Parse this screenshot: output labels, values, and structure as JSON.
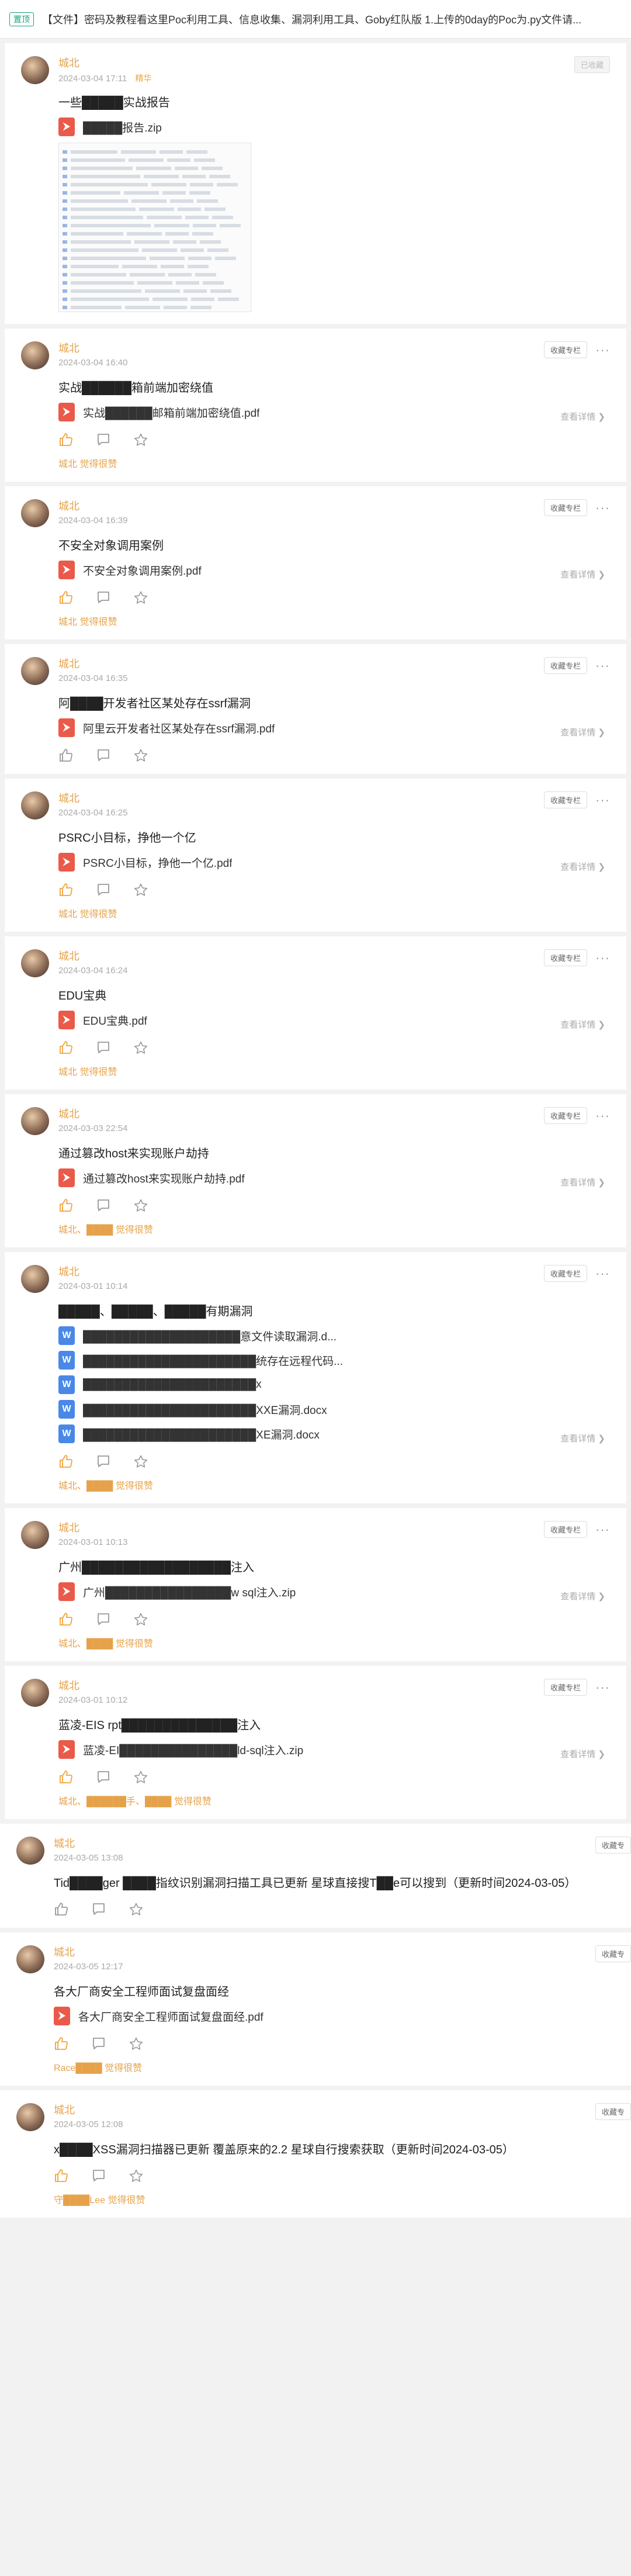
{
  "notice": {
    "tag": "置顶",
    "text": "【文件】密码及教程看这里Poc利用工具、信息收集、漏洞利用工具、Goby红队版 1.上传的0day的Poc为.py文件请..."
  },
  "labels": {
    "collect": "收藏专栏",
    "collected": "已收藏",
    "detail": "查看详情",
    "detail_arrow": "❯",
    "liked_suffix": "觉得很赞",
    "essence": "精华"
  },
  "posts": [
    {
      "author": "城北",
      "time": "2024-03-04 17:11",
      "essence": true,
      "fav": "已收藏",
      "title": "一些█████实战报告",
      "files": [
        {
          "type": "zip",
          "name": "█████报告.zip"
        }
      ],
      "screenshot": true,
      "liked": null
    },
    {
      "author": "城北",
      "time": "2024-03-04 16:40",
      "fav": "收藏专栏",
      "title": "实战██████箱前端加密绕值",
      "files": [
        {
          "type": "pdf",
          "name": "实战██████邮箱前端加密绕值.pdf"
        }
      ],
      "liked": "城北"
    },
    {
      "author": "城北",
      "time": "2024-03-04 16:39",
      "fav": "收藏专栏",
      "title": "不安全对象调用案例",
      "files": [
        {
          "type": "pdf",
          "name": "不安全对象调用案例.pdf"
        }
      ],
      "liked": "城北"
    },
    {
      "author": "城北",
      "time": "2024-03-04 16:35",
      "fav": "收藏专栏",
      "title": "阿████开发者社区某处存在ssrf漏洞",
      "files": [
        {
          "type": "pdf",
          "name": "阿里云开发者社区某处存在ssrf漏洞.pdf"
        }
      ],
      "liked": null
    },
    {
      "author": "城北",
      "time": "2024-03-04 16:25",
      "fav": "收藏专栏",
      "title": "PSRC小目标，挣他一个亿",
      "files": [
        {
          "type": "pdf",
          "name": "PSRC小目标，挣他一个亿.pdf"
        }
      ],
      "liked": "城北"
    },
    {
      "author": "城北",
      "time": "2024-03-04 16:24",
      "fav": "收藏专栏",
      "title": "EDU宝典",
      "files": [
        {
          "type": "pdf",
          "name": "EDU宝典.pdf"
        }
      ],
      "liked": "城北"
    },
    {
      "author": "城北",
      "time": "2024-03-03 22:54",
      "fav": "收藏专栏",
      "title": "通过篡改host来实现账户劫持",
      "files": [
        {
          "type": "pdf",
          "name": "通过篡改host来实现账户劫持.pdf"
        }
      ],
      "liked": "城北、████"
    },
    {
      "author": "城北",
      "time": "2024-03-01 10:14",
      "fav": "收藏专栏",
      "title": "█████、█████、█████有期漏洞",
      "files": [
        {
          "type": "doc",
          "name": "████████████████████意文件读取漏洞.d..."
        },
        {
          "type": "doc",
          "name": "██████████████████████统存在远程代码..."
        },
        {
          "type": "doc",
          "name": "██████████████████████x"
        },
        {
          "type": "doc",
          "name": "██████████████████████XXE漏洞.docx"
        },
        {
          "type": "doc",
          "name": "██████████████████████XE漏洞.docx"
        }
      ],
      "liked": "城北、████"
    },
    {
      "author": "城北",
      "time": "2024-03-01 10:13",
      "fav": "收藏专栏",
      "title": "广州██████████████████注入",
      "files": [
        {
          "type": "zip",
          "name": "广州████████████████w sql注入.zip"
        }
      ],
      "liked": "城北、████"
    },
    {
      "author": "城北",
      "time": "2024-03-01 10:12",
      "fav": "收藏专栏",
      "title": "蓝凌-EIS rpt██████████████注入",
      "files": [
        {
          "type": "zip",
          "name": "蓝凌-EI███████████████ld-sql注入.zip"
        }
      ],
      "liked": "城北、██████手、████"
    },
    {
      "author": "城北",
      "time": "2024-03-05 13:08",
      "fav": "收藏专",
      "wide": true,
      "title": "Tid████ger ████指纹识别漏洞扫描工具已更新 星球直接搜T██e可以搜到（更新时间2024-03-05）",
      "files": [],
      "liked": null
    },
    {
      "author": "城北",
      "time": "2024-03-05 12:17",
      "fav": "收藏专",
      "wide": true,
      "title": "各大厂商安全工程师面试复盘面经",
      "files": [
        {
          "type": "pdf",
          "name": "各大厂商安全工程师面试复盘面经.pdf"
        }
      ],
      "liked": "Race████"
    },
    {
      "author": "城北",
      "time": "2024-03-05 12:08",
      "fav": "收藏专",
      "wide": true,
      "title": "x████XSS漏洞扫描器已更新 覆盖原来的2.2 星球自行搜索获取（更新时间2024-03-05）",
      "files": [],
      "liked": "守████Lee"
    }
  ]
}
